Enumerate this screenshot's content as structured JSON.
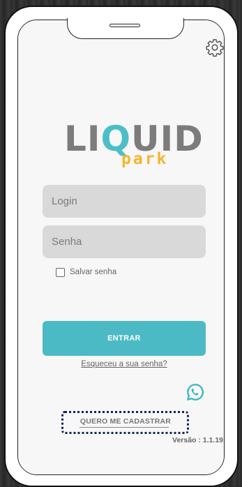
{
  "settings": {
    "icon": "gear-icon"
  },
  "logo": {
    "main_left": "LI",
    "main_q": "Q",
    "main_right": "UID",
    "sub": "park"
  },
  "login": {
    "placeholder": "Login"
  },
  "password": {
    "placeholder": "Senha"
  },
  "remember": {
    "label": "Salvar senha",
    "checked": false
  },
  "actions": {
    "enter_label": "ENTRAR",
    "forgot_label": "Esqueceu a sua senha?",
    "register_label": "QUERO ME CADASTRAR"
  },
  "contact": {
    "icon": "whatsapp-icon"
  },
  "footer": {
    "version": "Versão : 1.1.19"
  },
  "colors": {
    "accent": "#4cbac4",
    "logo_gray": "#7c7c7c",
    "logo_yellow": "#f6b52b",
    "input_bg": "#d9d9d9",
    "dotted_border": "#17245c"
  }
}
